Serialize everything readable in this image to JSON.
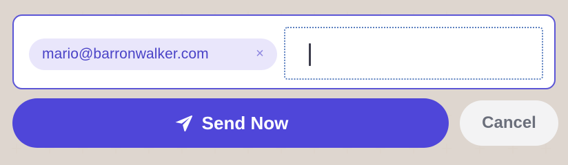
{
  "recipients": [
    {
      "email": "mario@barronwalker.com",
      "remove_glyph": "×"
    }
  ],
  "input": {
    "value": "",
    "placeholder": ""
  },
  "actions": {
    "send_label": "Send Now",
    "send_icon": "paper-plane-icon",
    "cancel_label": "Cancel"
  },
  "colors": {
    "accent": "#4f46d9",
    "chip_background": "#e9e6fb",
    "chip_text": "#4a43c7",
    "border": "#5b55d6",
    "cancel_background": "#f3f3f4",
    "cancel_text": "#6b6f7b",
    "page_background": "#e9e2dc"
  }
}
